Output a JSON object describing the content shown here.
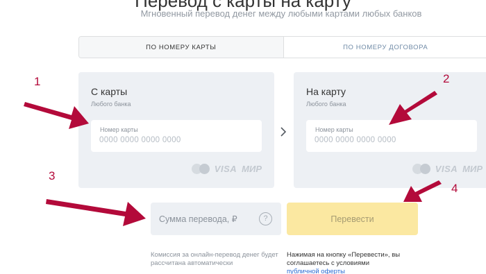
{
  "header": {
    "title": "Перевод с карты на карту",
    "subtitle": "Мгновенный перевод денег между любыми картами любых банков"
  },
  "tabs": [
    {
      "label": "ПО НОМЕРУ КАРТЫ",
      "active": true
    },
    {
      "label": "ПО НОМЕРУ ДОГОВОРА",
      "active": false
    }
  ],
  "from_card": {
    "title": "С карты",
    "subtitle": "Любого банка",
    "field_label": "Номер карты",
    "placeholder": "0000 0000 0000 0000",
    "value": ""
  },
  "to_card": {
    "title": "На карту",
    "subtitle": "Любого банка",
    "field_label": "Номер карты",
    "placeholder": "0000 0000 0000 0000",
    "value": ""
  },
  "card_logos": {
    "icons": [
      "mastercard-icon",
      "visa-logo",
      "mir-logo"
    ],
    "visa": "VISA",
    "mir": "МИР"
  },
  "swap_icon": "chevron-right-icon",
  "amount": {
    "placeholder": "Сумма перевода, ₽",
    "value": "",
    "help": "?"
  },
  "submit": {
    "label": "Перевести"
  },
  "notes": {
    "commission": "Комиссия за онлайн-перевод денег будет рассчитана автоматически",
    "consent": "Нажимая на кнопку «Перевести», вы соглашаетесь с условиями",
    "offer_link": "публичной оферты"
  },
  "annotations": [
    "1",
    "2",
    "3",
    "4"
  ],
  "colors": {
    "accent_yellow": "#fbe8a1",
    "panel_bg": "#edf0f4",
    "annotation_red": "#b30a3a",
    "link_blue": "#2a6bd3"
  }
}
